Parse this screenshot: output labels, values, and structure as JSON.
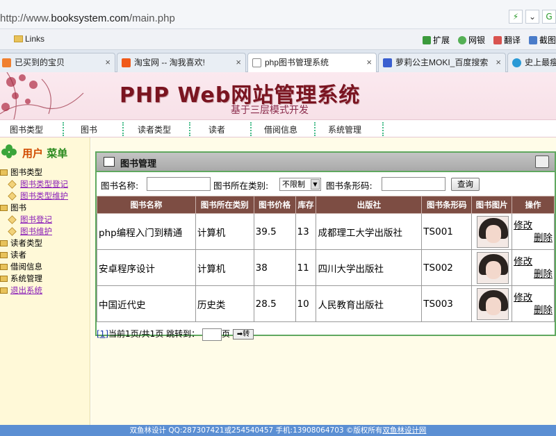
{
  "browser": {
    "url_prefix": "http://www.",
    "url_domain": "booksystem.com",
    "url_path": "/main.php",
    "bookmarks": {
      "folder": "Links"
    },
    "toolbar_items": [
      "扩展",
      "网银",
      "翻译",
      "截图"
    ],
    "tabs": [
      {
        "label": "已买到的宝贝",
        "close": "×"
      },
      {
        "label": "淘宝网 -- 淘我喜欢!",
        "close": "×"
      },
      {
        "label": "php图书管理系统",
        "close": "×"
      },
      {
        "label": "萝莉公主MOKI_百度搜索",
        "close": "×"
      },
      {
        "label": "史上最瘦女"
      }
    ]
  },
  "banner": {
    "title": "PHP Web网站管理系统",
    "subtitle": "基于三层模式开发"
  },
  "nav": [
    "图书类型",
    "图书",
    "读者类型",
    "读者",
    "借阅信息",
    "系统管理"
  ],
  "sidebar": {
    "title_a": "用户",
    "title_b": "菜单",
    "tree": [
      {
        "label": "图书类型",
        "kind": "folder"
      },
      {
        "label": "图书类型登记",
        "kind": "link"
      },
      {
        "label": "图书类型维护",
        "kind": "link"
      },
      {
        "label": "图书",
        "kind": "folder"
      },
      {
        "label": "图书登记",
        "kind": "link"
      },
      {
        "label": "图书维护",
        "kind": "link"
      },
      {
        "label": "读者类型",
        "kind": "folder"
      },
      {
        "label": "读者",
        "kind": "folder"
      },
      {
        "label": "借阅信息",
        "kind": "folder"
      },
      {
        "label": "系统管理",
        "kind": "folder"
      },
      {
        "label": "退出系统",
        "kind": "link"
      }
    ]
  },
  "panel": {
    "title": "图书管理",
    "search": {
      "name_label": "图书名称:",
      "name_value": "",
      "category_label": "图书所在类别:",
      "category_selected": "不限制",
      "barcode_label": "图书条形码:",
      "barcode_value": "",
      "query_button": "查询"
    },
    "table": {
      "headers": [
        "图书名称",
        "图书所在类别",
        "图书价格",
        "库存",
        "出版社",
        "图书条形码",
        "图书图片",
        "操作"
      ],
      "rows": [
        {
          "name": "php编程入门到精通",
          "category": "计算机",
          "price": "39.5",
          "stock": "13",
          "publisher": "成都理工大学出版社",
          "barcode": "TS001",
          "edit": "修改",
          "delete": "删除"
        },
        {
          "name": "安卓程序设计",
          "category": "计算机",
          "price": "38",
          "stock": "11",
          "publisher": "四川大学出版社",
          "barcode": "TS002",
          "edit": "修改",
          "delete": "删除"
        },
        {
          "name": "中国近代史",
          "category": "历史类",
          "price": "28.5",
          "stock": "10",
          "publisher": "人民教育出版社",
          "barcode": "TS003",
          "edit": "修改",
          "delete": "删除"
        }
      ]
    },
    "pager": {
      "page_link": "[1]",
      "info": "当前1页/共1页 跳转到：",
      "page_unit": "页",
      "go_button": "➡转"
    }
  },
  "footer": {
    "text": "双鱼林设计 QQ:287307421或254540457 手机:13908064703 ©版权所有",
    "link": "双鱼林设计网"
  }
}
